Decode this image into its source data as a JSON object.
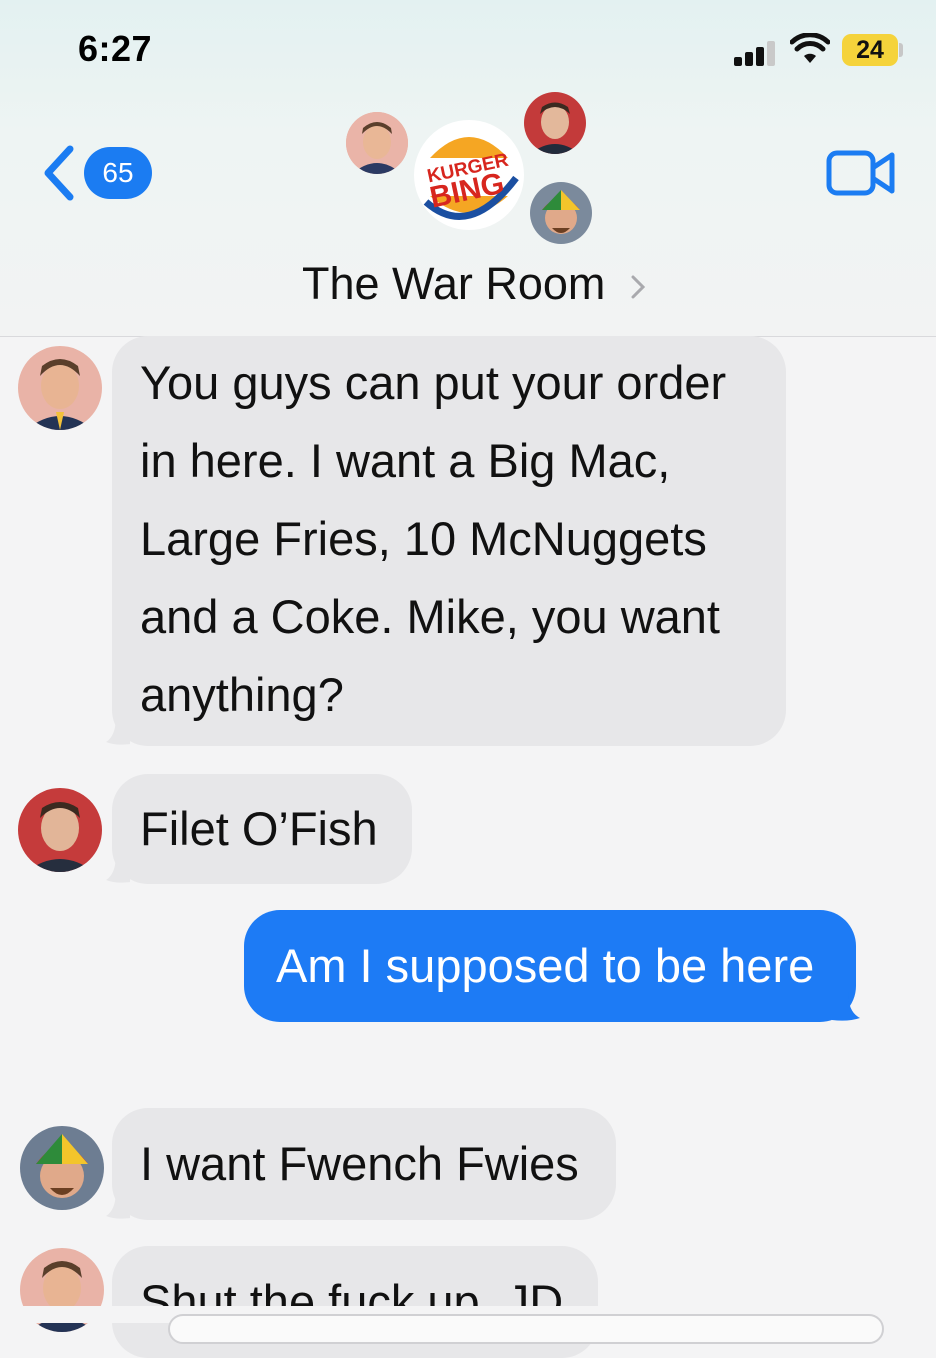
{
  "status_bar": {
    "time": "6:27",
    "battery": "24",
    "signal_icon": "cellular-signal-icon",
    "wifi_icon": "wifi-icon"
  },
  "nav": {
    "back_count": "65",
    "back_icon": "chevron-left-icon",
    "video_icon": "video-camera-icon",
    "accent_color": "#1b7cf2"
  },
  "group": {
    "name": "The War Room",
    "logo_text_line1": "KURGER",
    "logo_text_line2": "BING",
    "chevron_icon": "chevron-right-icon"
  },
  "messages": [
    {
      "from": "other",
      "lines": [
        "You guys can put your order",
        "in here. I want a Big Mac,",
        "Large Fries, 10 McNuggets",
        "and a Coke. Mike, you want",
        "anything?"
      ]
    },
    {
      "from": "other",
      "lines": [
        "Filet O’Fish"
      ]
    },
    {
      "from": "me",
      "lines": [
        "Am I supposed to be here"
      ]
    },
    {
      "from": "other",
      "lines": [
        "I want Fwench Fwies"
      ]
    },
    {
      "from": "other",
      "lines": [
        "Shut the fuck up, JD"
      ]
    }
  ],
  "colors": {
    "bubble_gray": "#e7e7e9",
    "bubble_blue": "#1d7bf5",
    "background": "#f4f4f5"
  }
}
